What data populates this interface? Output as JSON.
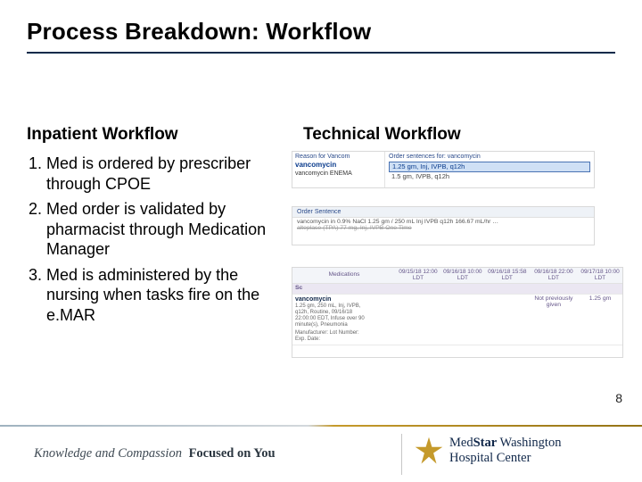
{
  "title": "Process Breakdown: Workflow",
  "left": {
    "heading": "Inpatient Workflow",
    "items": [
      "Med is ordered by prescriber through CPOE",
      "Med order is validated by pharmacist through Medication Manager",
      "Med is administered by the nursing when tasks fire on the e.MAR"
    ]
  },
  "right_heading": "Technical Workflow",
  "shot1": {
    "reason_label": "Reason for Vancom",
    "drug": "vancomycin",
    "enema": "vancomycin ENEMA",
    "sentences_label": "Order sentences for: vancomycin",
    "row_selected": "1.25 gm, Inj, IVPB, q12h",
    "row_other": "1.5 gm, IVPB, q12h"
  },
  "shot2": {
    "head": "Order Sentence",
    "line1": "vancomycin in 0.9% NaCl 1.25 gm / 250 mL Inj IVPB q12h 166.67 mL/hr …",
    "line2_struck": "alteplase (TPA) 77 mg, Inj, IVPB One Time"
  },
  "shot3": {
    "columns": [
      "Medications",
      "09/15/18 12:00 LDT",
      "09/16/18 10:00 LDT",
      "09/16/18 15:58 LDT",
      "09/16/18 22:00 LDT",
      "09/17/18 10:00 LDT"
    ],
    "section": "Sc",
    "drug": "vancomycin",
    "detail1": "1.25 gm, 250 mL, Inj, IVPB,",
    "detail2": "q12h, Routine, 09/16/18",
    "detail3": "22:00:00 EDT, Infuse over 90",
    "detail4": "minute(s), Pneumonia",
    "detail5": "Manufacturer: Lot Number:",
    "detail6": "Exp. Date:",
    "cell_not": "Not previously given",
    "cell_dose": "1.25 gm"
  },
  "page_number": "8",
  "footer": {
    "left_italic": "Knowledge and Compassion",
    "left_bold": "Focused on You",
    "brand_line1a": "Med",
    "brand_line1b": "Star",
    "brand_line1c": " Washington",
    "brand_line2": "Hospital Center"
  }
}
